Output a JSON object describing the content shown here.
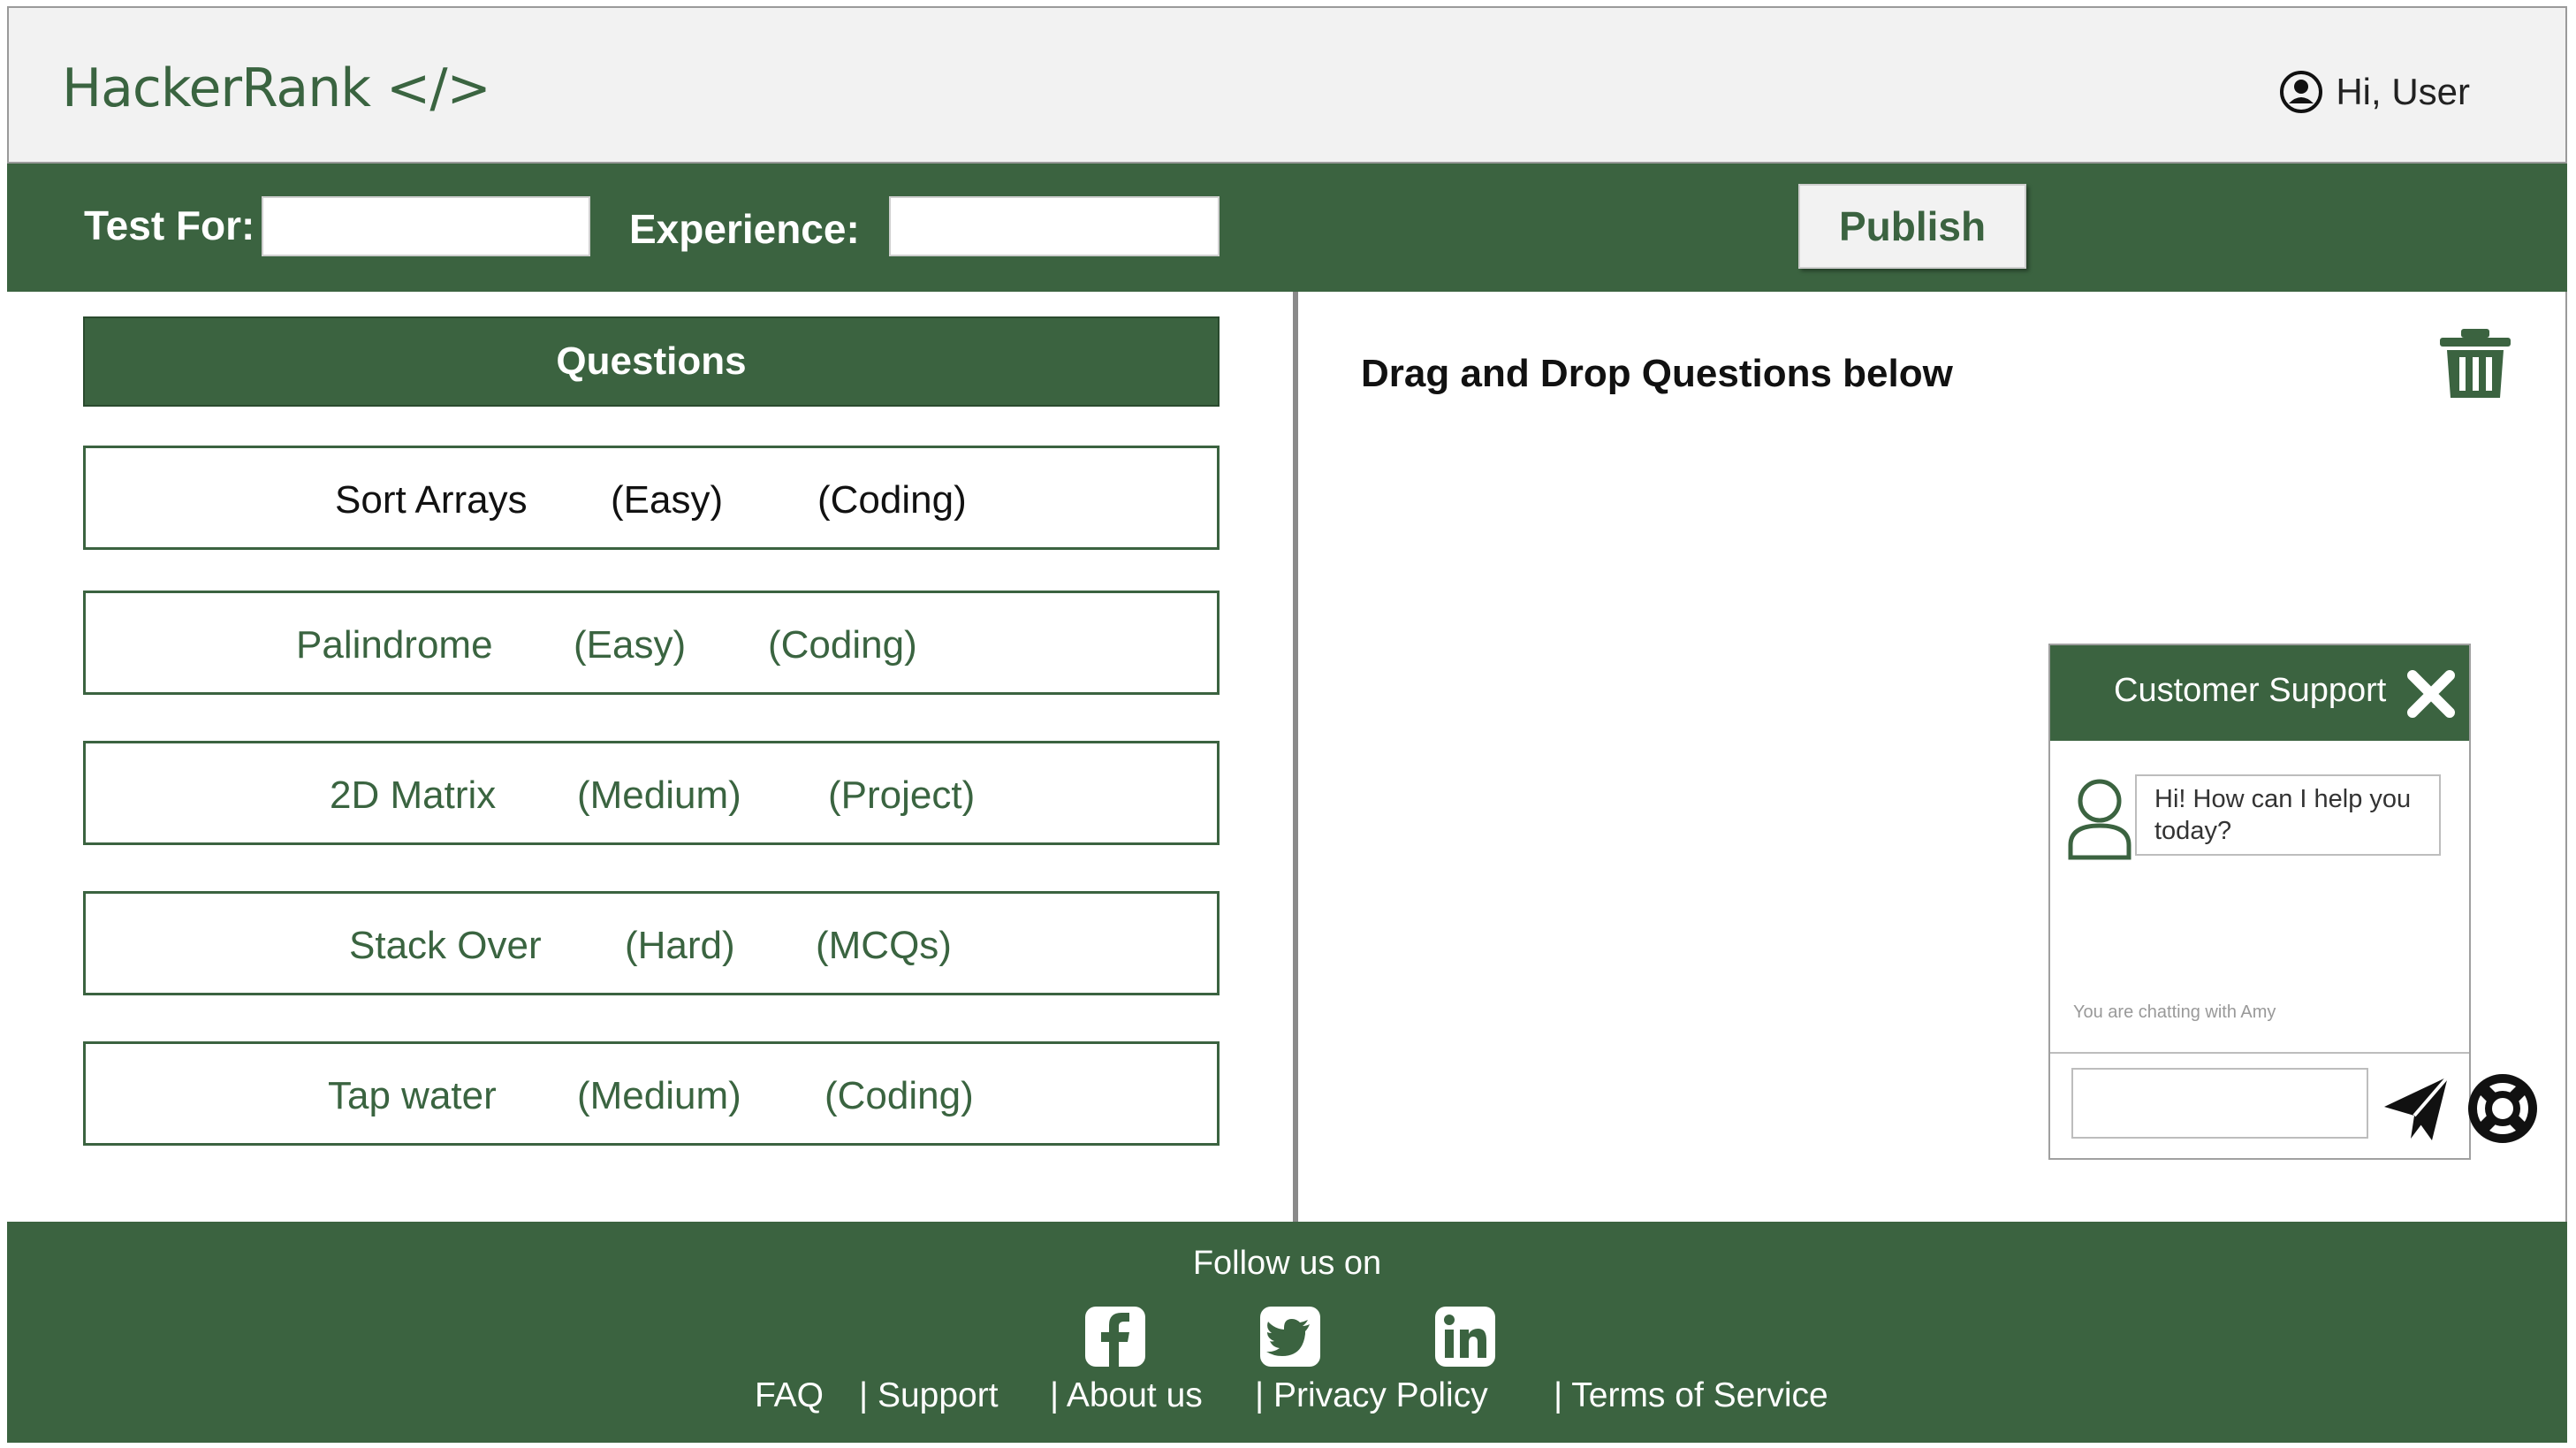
{
  "header": {
    "logo": "HackerRank </>",
    "greeting": "Hi, User",
    "user_icon": "user-circle-icon"
  },
  "toolbar": {
    "test_for_label": "Test For:",
    "test_for_value": "",
    "experience_label": "Experience:",
    "experience_value": "",
    "publish_label": "Publish"
  },
  "questions": {
    "header": "Questions",
    "items": [
      {
        "name": "Sort Arrays",
        "difficulty": "(Easy)",
        "type": "(Coding)"
      },
      {
        "name": "Palindrome",
        "difficulty": "(Easy)",
        "type": "(Coding)"
      },
      {
        "name": "2D Matrix",
        "difficulty": "(Medium)",
        "type": "(Project)"
      },
      {
        "name": "Stack Over",
        "difficulty": "(Hard)",
        "type": "(MCQs)"
      },
      {
        "name": "Tap water",
        "difficulty": "(Medium)",
        "type": "(Coding)"
      }
    ]
  },
  "drop_area": {
    "title": "Drag and Drop Questions below",
    "trash_icon": "trash-icon"
  },
  "support": {
    "title": "Customer Support",
    "message": "Hi! How can I help you today?",
    "chatting_with": "You are chatting with Amy",
    "input_value": "",
    "close_icon": "close-icon",
    "send_icon": "send-icon",
    "lifebuoy_icon": "lifebuoy-icon"
  },
  "footer": {
    "follow": "Follow us on",
    "social": [
      "facebook-icon",
      "twitter-icon",
      "linkedin-icon"
    ],
    "links": [
      "FAQ",
      "| Support",
      "| About us",
      "| Privacy Policy",
      "| Terms of Service"
    ]
  },
  "colors": {
    "brand_green": "#3b6340",
    "header_bg": "#f2f2f2",
    "text_green": "#3a6440"
  }
}
